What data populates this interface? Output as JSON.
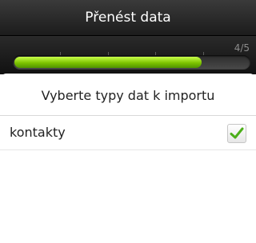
{
  "window": {
    "title": "Přenést data"
  },
  "progress": {
    "step_text": "4/5",
    "fraction": 0.8
  },
  "content": {
    "heading": "Vyberte typy dat k importu",
    "items": [
      {
        "label": "kontakty",
        "checked": true
      }
    ]
  },
  "colors": {
    "checkmark": "#4caf1a"
  }
}
